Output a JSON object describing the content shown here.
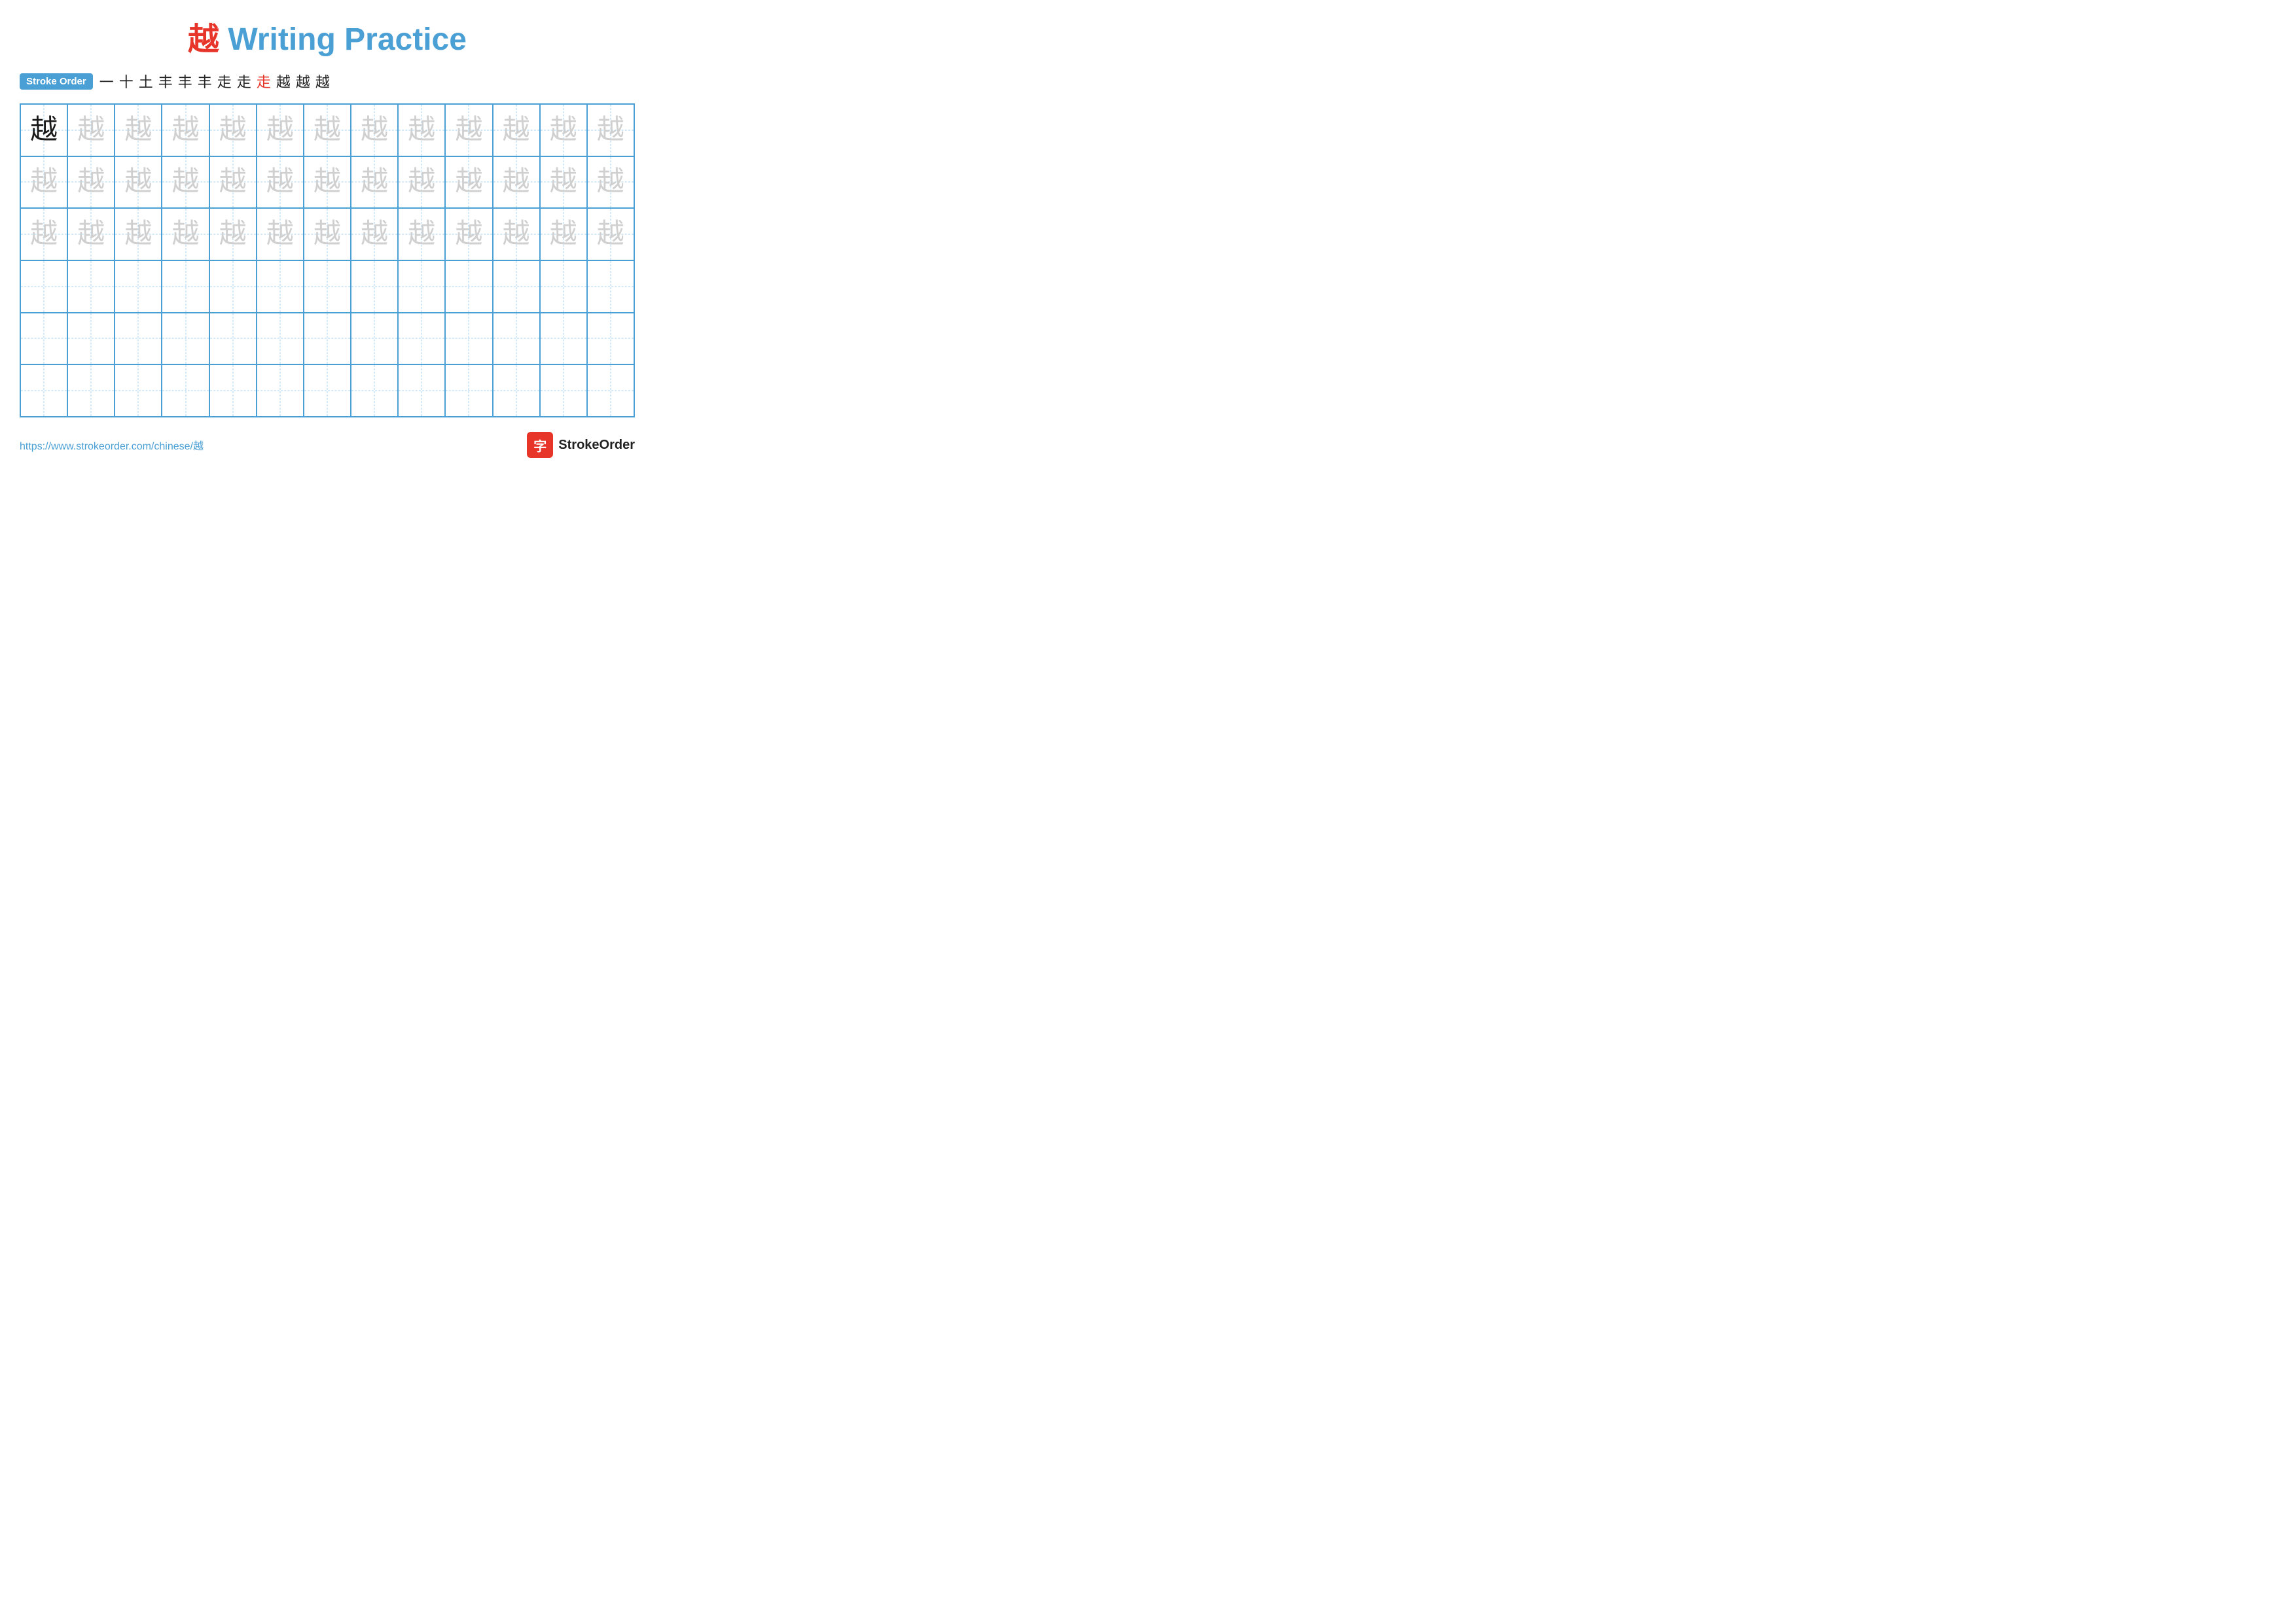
{
  "title": {
    "char": "越",
    "text": " Writing Practice"
  },
  "stroke_order": {
    "badge_label": "Stroke Order",
    "strokes": [
      "一",
      "十",
      "土",
      "丰",
      "丰",
      "丰",
      "走",
      "走",
      "走",
      "越",
      "越",
      "越"
    ]
  },
  "grid": {
    "cols": 13,
    "rows": 6,
    "char": "越",
    "row_types": [
      "dark_then_light",
      "light",
      "light",
      "empty",
      "empty",
      "empty"
    ]
  },
  "footer": {
    "url": "https://www.strokeorder.com/chinese/越",
    "logo_char": "字",
    "logo_text": "StrokeOrder"
  }
}
